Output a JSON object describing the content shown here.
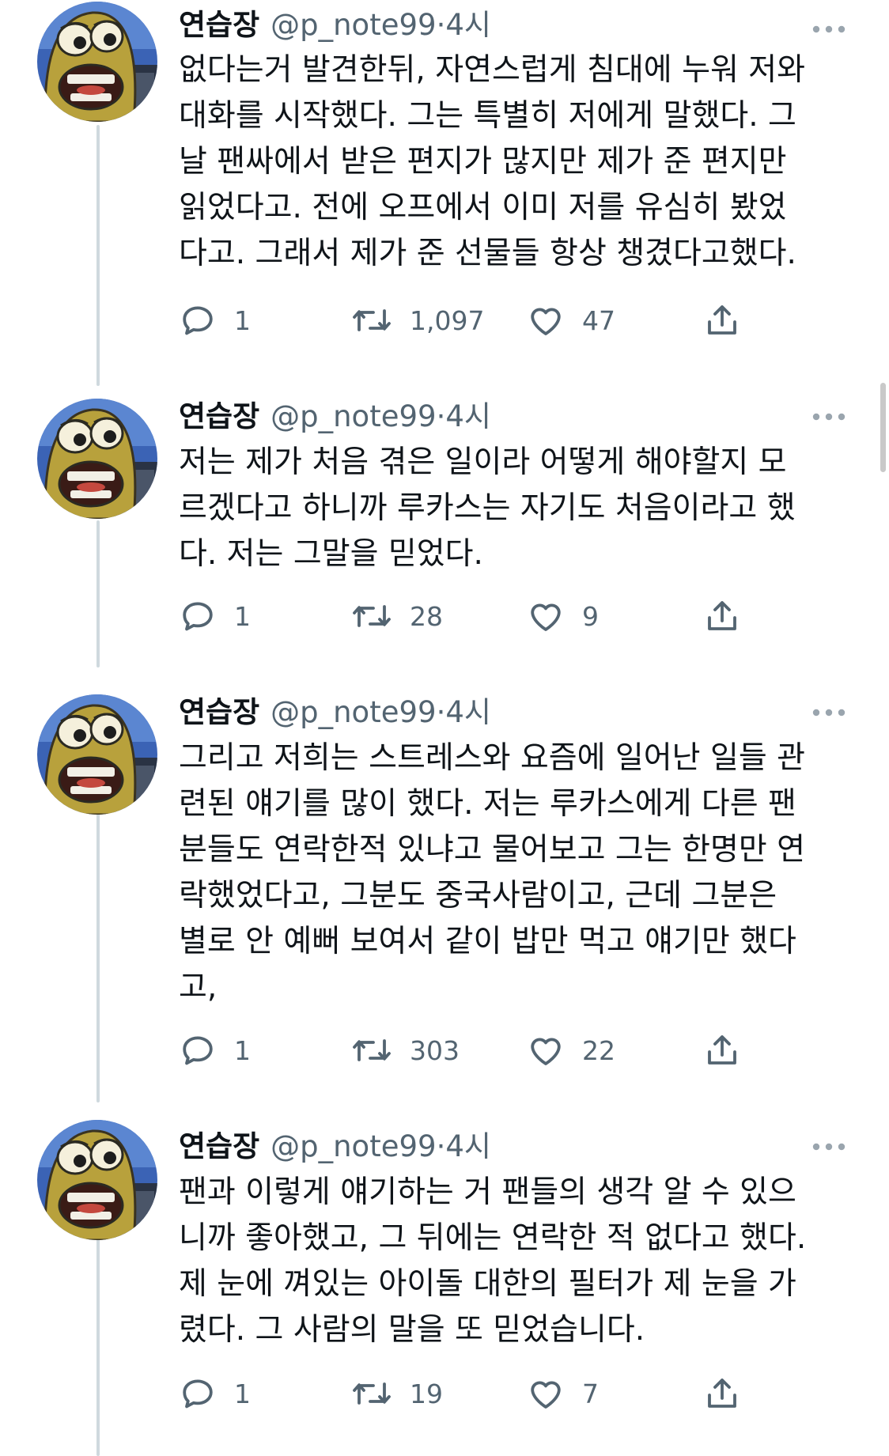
{
  "tweets": [
    {
      "name": "연습장",
      "handle": "@p_note99",
      "separator": "·",
      "time": "4시",
      "text": "없다는거 발견한뒤, 자연스럽게 침대에 누워 저와\n대화를 시작했다. 그는 특별히 저에게 말했다. 그\n날 팬싸에서 받은 편지가 많지만 제가 준 편지만\n읽었다고. 전에 오프에서 이미 저를 유심히 봤었\n다고. 그래서 제가 준 선물들 항상 챙겼다고했다.",
      "replies": "1",
      "retweets": "1,097",
      "likes": "47"
    },
    {
      "name": "연습장",
      "handle": "@p_note99",
      "separator": "·",
      "time": "4시",
      "text": "저는 제가 처음 겪은 일이라 어떻게 해야할지 모\n르겠다고 하니까 루카스는 자기도 처음이라고 했\n다. 저는 그말을 믿었다.",
      "replies": "1",
      "retweets": "28",
      "likes": "9"
    },
    {
      "name": "연습장",
      "handle": "@p_note99",
      "separator": "·",
      "time": "4시",
      "text": "그리고 저희는 스트레스와 요즘에 일어난 일들 관\n련된 얘기를 많이 했다. 저는 루카스에게 다른 팬\n분들도 연락한적 있냐고 물어보고 그는 한명만 연\n락했었다고, 그분도 중국사람이고, 근데 그분은\n별로 안 예뻐 보여서 같이 밥만 먹고 얘기만 했다\n고,",
      "replies": "1",
      "retweets": "303",
      "likes": "22"
    },
    {
      "name": "연습장",
      "handle": "@p_note99",
      "separator": "·",
      "time": "4시",
      "text": "팬과 이렇게 얘기하는 거 팬들의 생각 알 수 있으\n니까 좋아했고, 그 뒤에는 연락한 적 없다고 했다.\n제 눈에 껴있는 아이돌 대한의 필터가 제 눈을 가\n렸다. 그 사람의 말을 또 믿었습니다.",
      "replies": "1",
      "retweets": "19",
      "likes": "7"
    }
  ],
  "icons": {
    "reply": "reply-icon",
    "retweet": "retweet-icon",
    "like": "heart-icon",
    "share": "share-icon",
    "more": "more-options-icon",
    "avatar": "avatar-cartoon-fish"
  },
  "colors": {
    "text_primary": "#0f1419",
    "text_secondary": "#536471",
    "thread_line": "#cfd9de",
    "avatar_bg": "#3b63b5",
    "avatar_face": "#bfa23a"
  }
}
